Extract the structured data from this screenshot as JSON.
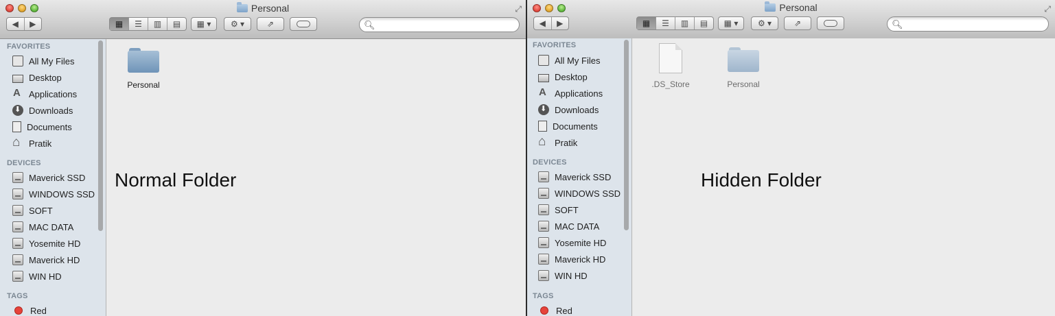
{
  "windows": [
    {
      "title": "Personal",
      "sidebar": {
        "favorites_header": "FAVORITES",
        "favorites": [
          {
            "label": "All My Files",
            "icon": "all-files-icon"
          },
          {
            "label": "Desktop",
            "icon": "desktop-icon"
          },
          {
            "label": "Applications",
            "icon": "applications-icon"
          },
          {
            "label": "Downloads",
            "icon": "downloads-icon"
          },
          {
            "label": "Documents",
            "icon": "documents-icon"
          },
          {
            "label": "Pratik",
            "icon": "home-icon"
          }
        ],
        "devices_header": "DEVICES",
        "devices": [
          "Maverick SSD",
          "WINDOWS SSD",
          "SOFT",
          "MAC DATA",
          "Yosemite HD",
          "Maverick HD",
          "WIN HD"
        ],
        "tags_header": "TAGS",
        "tags": [
          {
            "label": "Red",
            "color": "#e6433b"
          }
        ]
      },
      "items": [
        {
          "name": "Personal",
          "kind": "folder",
          "hidden": false
        }
      ],
      "annotation": "Normal Folder"
    },
    {
      "title": "Personal",
      "sidebar": {
        "favorites_header": "FAVORITES",
        "favorites": [
          {
            "label": "All My Files",
            "icon": "all-files-icon"
          },
          {
            "label": "Desktop",
            "icon": "desktop-icon"
          },
          {
            "label": "Applications",
            "icon": "applications-icon"
          },
          {
            "label": "Downloads",
            "icon": "downloads-icon"
          },
          {
            "label": "Documents",
            "icon": "documents-icon"
          },
          {
            "label": "Pratik",
            "icon": "home-icon"
          }
        ],
        "devices_header": "DEVICES",
        "devices": [
          "Maverick SSD",
          "WINDOWS SSD",
          "SOFT",
          "MAC DATA",
          "Yosemite HD",
          "Maverick HD",
          "WIN HD"
        ],
        "tags_header": "TAGS",
        "tags": [
          {
            "label": "Red",
            "color": "#e6433b"
          }
        ]
      },
      "items": [
        {
          "name": ".DS_Store",
          "kind": "file",
          "hidden": true
        },
        {
          "name": "Personal",
          "kind": "folder",
          "hidden": true
        }
      ],
      "annotation": "Hidden Folder"
    }
  ],
  "colors": {
    "arrow": "#e0473b",
    "tag_red": "#e6433b",
    "sidebar_bg": "#dde4eb"
  }
}
